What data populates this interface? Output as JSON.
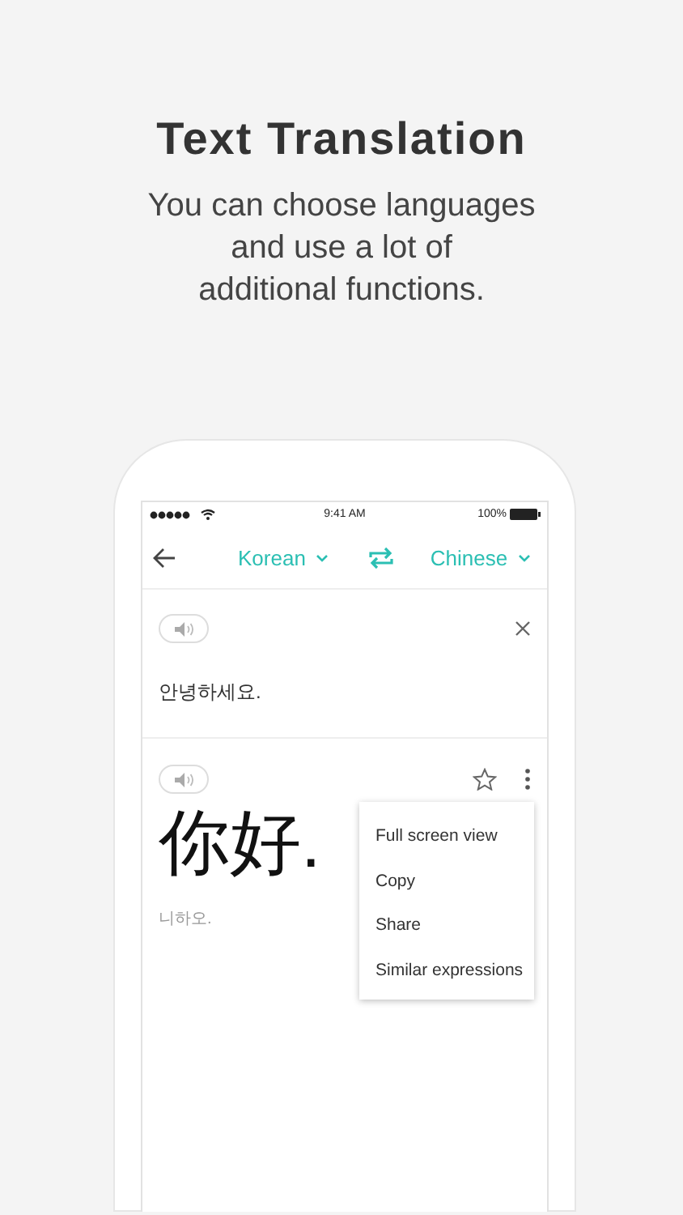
{
  "header": {
    "title": "Text Translation",
    "subtitle_lines": [
      "You can choose languages",
      "and use a lot of",
      "additional functions."
    ]
  },
  "status_bar": {
    "time": "9:41 AM",
    "battery": "100%"
  },
  "toolbar": {
    "source_language": "Korean",
    "target_language": "Chinese"
  },
  "source": {
    "text": "안녕하세요."
  },
  "result": {
    "text": "你好.",
    "pronunciation": "니하오.",
    "menu": [
      {
        "label": "Full screen view"
      },
      {
        "label": "Copy"
      },
      {
        "label": "Share"
      },
      {
        "label": "Similar expressions"
      }
    ]
  }
}
